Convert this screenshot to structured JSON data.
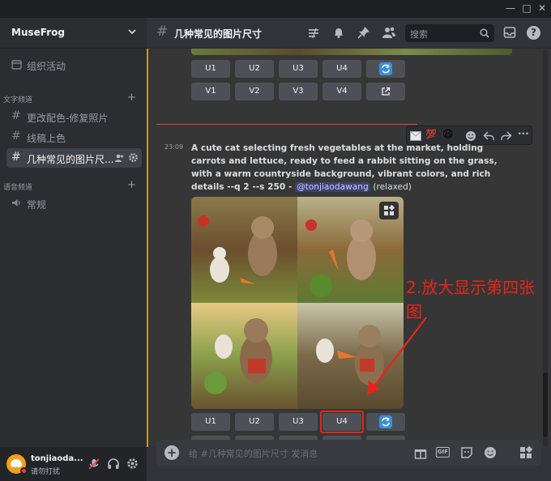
{
  "window": {
    "minimize": "—",
    "maximize": "□",
    "close": "✕"
  },
  "server": {
    "name": "MuseFrog"
  },
  "sidebar": {
    "top_item": "组织活动",
    "text_category": "文字频道",
    "text_channels": [
      "更改配色-修复照片",
      "线稿上色",
      "几种常见的图片尺..."
    ],
    "voice_category": "语音频道",
    "voice_channels": [
      "常规"
    ]
  },
  "user": {
    "name": "tonjiaoda...",
    "status": "请勿打扰"
  },
  "channel": {
    "name": "几种常见的图片尺寸",
    "search_placeholder": "搜索"
  },
  "message": {
    "time": "23:09",
    "text": "A cute cat selecting fresh vegetables at the market, holding carrots and lettuce, ready to feed a rabbit sitting on the grass, with a warm countryside background, vibrant colors, and rich details --q 2 --s 250 -",
    "mention": "@tonjiaodawang",
    "mode": "(relaxed)"
  },
  "buttons": {
    "u": [
      "U1",
      "U2",
      "U3",
      "U4"
    ],
    "v": [
      "V1",
      "V2",
      "V3",
      "V4"
    ]
  },
  "annotation": "2.放大显示第四张图",
  "input": {
    "placeholder": "给 #几种常见的图片尺寸 发消息"
  },
  "colors": {
    "accent": "#5865f2",
    "annotation": "#e8231a",
    "online": "#23a55a",
    "dnd": "#f23f43"
  }
}
